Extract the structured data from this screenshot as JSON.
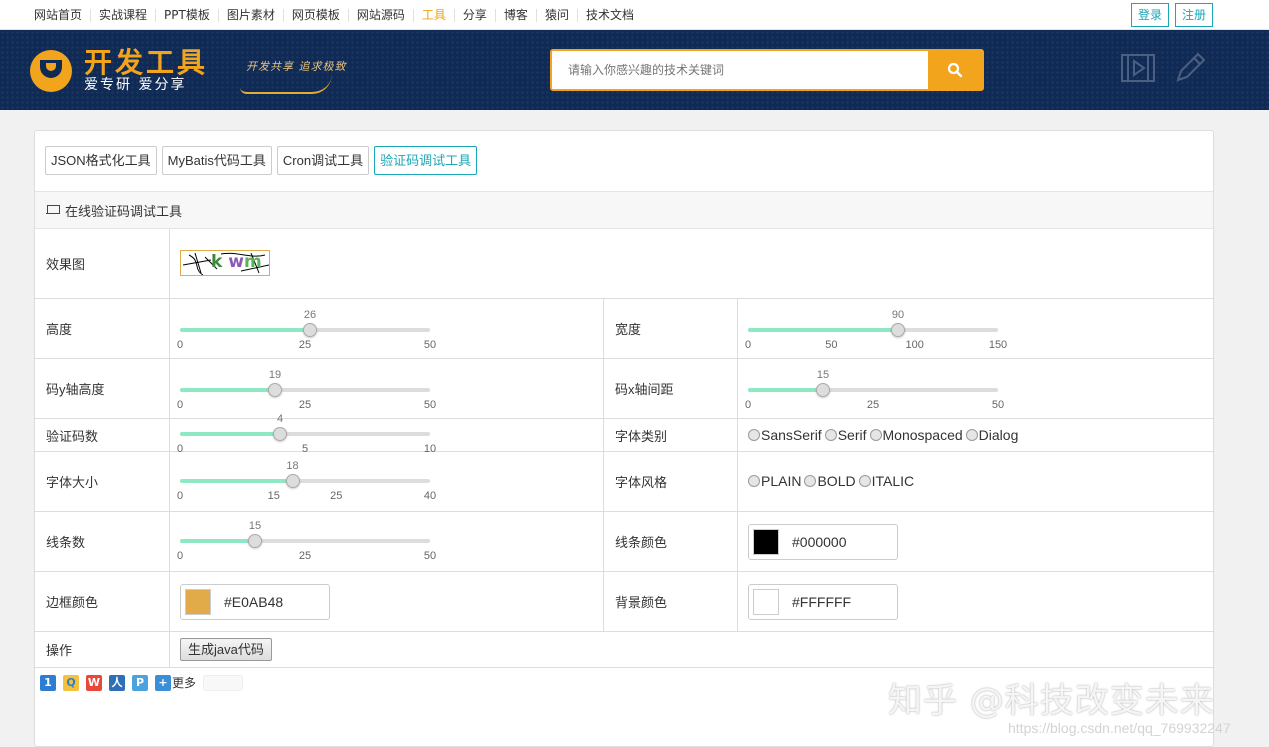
{
  "topnav": {
    "links": [
      "网站首页",
      "实战课程",
      "PPT模板",
      "图片素材",
      "网页模板",
      "网站源码",
      "工具",
      "分享",
      "博客",
      "猿问",
      "技术文档"
    ],
    "active": "工具",
    "login": "登录",
    "register": "注册"
  },
  "header": {
    "logo_title": "开发工具",
    "logo_sub": "爱专研 爱分享",
    "slogan": "开发共享 追求极致",
    "search_placeholder": "请输入你感兴趣的技术关键词",
    "brand_color": "#f2a41c",
    "icons": [
      "search-icon",
      "video-icon",
      "pencil-icon"
    ]
  },
  "tabs": [
    {
      "label": "JSON格式化工具",
      "active": false
    },
    {
      "label": "MyBatis代码工具",
      "active": false
    },
    {
      "label": "Cron调试工具",
      "active": false
    },
    {
      "label": "验证码调试工具",
      "active": true
    }
  ],
  "section_title": "在线验证码调试工具",
  "form": {
    "preview_label": "效果图",
    "captcha_text": "k wm",
    "height": {
      "label": "高度",
      "value": 26,
      "min": 0,
      "max": 50,
      "ticks": [
        0,
        25,
        50
      ]
    },
    "width": {
      "label": "宽度",
      "value": 90,
      "min": 0,
      "max": 150,
      "ticks": [
        0,
        50,
        100,
        150
      ]
    },
    "y_height": {
      "label": "码y轴高度",
      "value": 19,
      "min": 0,
      "max": 50,
      "ticks": [
        0,
        25,
        50
      ]
    },
    "x_spacing": {
      "label": "码x轴间距",
      "value": 15,
      "min": 0,
      "max": 50,
      "ticks": [
        0,
        25,
        50
      ]
    },
    "count": {
      "label": "验证码数",
      "value": 4,
      "min": 0,
      "max": 10,
      "ticks": [
        0,
        5,
        10
      ]
    },
    "font_type": {
      "label": "字体类别",
      "options": [
        "SansSerif",
        "Serif",
        "Monospaced",
        "Dialog"
      ]
    },
    "font_size": {
      "label": "字体大小",
      "value": 18,
      "min": 0,
      "max": 40,
      "ticks": [
        0,
        15,
        25,
        40
      ]
    },
    "font_style": {
      "label": "字体风格",
      "options": [
        "PLAIN",
        "BOLD",
        "ITALIC"
      ]
    },
    "lines": {
      "label": "线条数",
      "value": 15,
      "min": 0,
      "max": 50,
      "ticks": [
        0,
        25,
        50
      ]
    },
    "line_color": {
      "label": "线条颜色",
      "value": "#000000"
    },
    "border_color": {
      "label": "边框颜色",
      "value": "#E0AB48"
    },
    "bg_color": {
      "label": "背景颜色",
      "value": "#FFFFFF"
    },
    "action_label": "操作",
    "generate_button": "生成java代码"
  },
  "share": {
    "more": "更多",
    "icons": [
      "qzone-icon",
      "qq-icon",
      "weibo-icon",
      "renren-icon",
      "pengyou-icon",
      "more-icon"
    ]
  },
  "watermark": {
    "text": "知乎 @科技改变未来",
    "url": "https://blog.csdn.net/qq_769932247"
  }
}
